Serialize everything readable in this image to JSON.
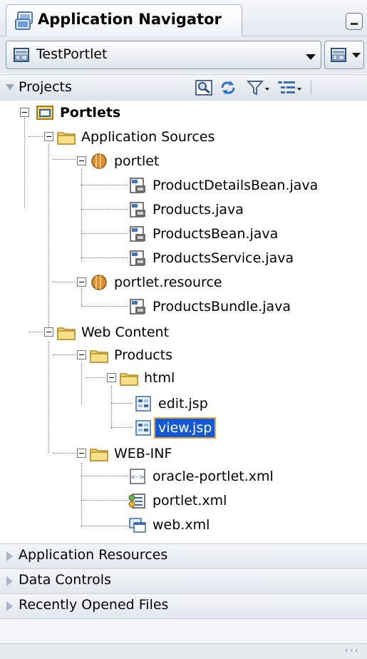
{
  "header": {
    "title": "Application Navigator"
  },
  "application": {
    "name": "TestPortlet"
  },
  "projects": {
    "label": "Projects"
  },
  "tree": {
    "root": "Portlets",
    "application_sources": "Application Sources",
    "pkg_portlet": "portlet",
    "files_portlet": [
      "ProductDetailsBean.java",
      "Products.java",
      "ProductsBean.java",
      "ProductsService.java"
    ],
    "pkg_resource": "portlet.resource",
    "files_resource": [
      "ProductsBundle.java"
    ],
    "web_content": "Web Content",
    "products": "Products",
    "html": "html",
    "edit_jsp": "edit.jsp",
    "view_jsp": "view.jsp",
    "web_inf": "WEB-INF",
    "oracle_portlet": "oracle-portlet.xml",
    "portlet_xml": "portlet.xml",
    "web_xml": "web.xml"
  },
  "sections": [
    "Application Resources",
    "Data Controls",
    "Recently Opened Files"
  ],
  "colors": {
    "selection": "#1558d6",
    "selection_outline": "#e8a33a",
    "folder": "#f2d36b"
  }
}
